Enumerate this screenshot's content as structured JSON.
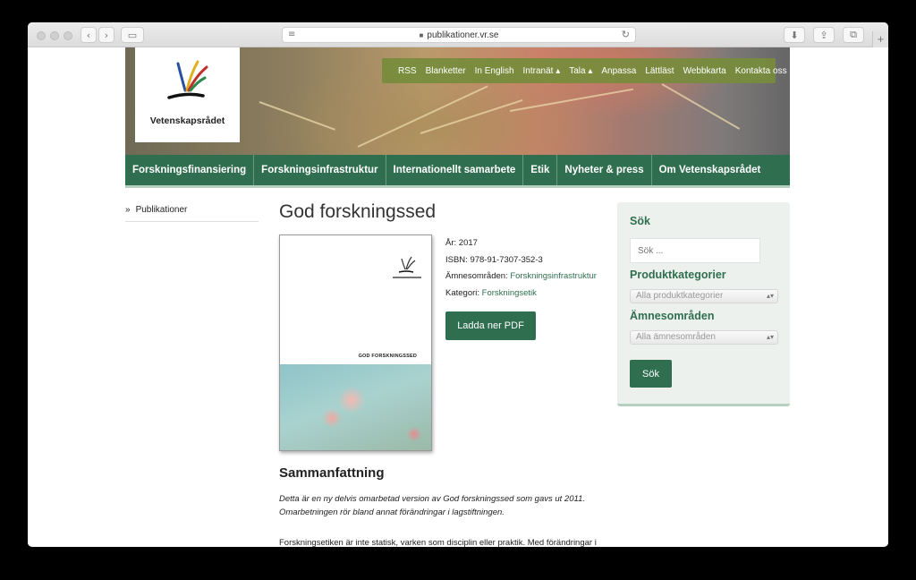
{
  "browser": {
    "url": "publikationer.vr.se",
    "icons": {
      "back": "‹",
      "forward": "›",
      "sidebar": "▭",
      "reader": "≡",
      "reload": "↻",
      "download": "⬇",
      "share": "⇪",
      "tabs": "⧉",
      "new_tab": "+"
    }
  },
  "site": {
    "logo_text": "Vetenskapsrådet",
    "top_links": [
      "RSS",
      "Blanketter",
      "In English",
      "Intranät ▴",
      "Tala ▴",
      "Anpassa",
      "Lättläst",
      "Webbkarta",
      "Kontakta oss"
    ],
    "main_nav": [
      "Forskningsfinansiering",
      "Forskningsinfrastruktur",
      "Internationellt samarbete",
      "Etik",
      "Nyheter & press",
      "Om Vetenskapsrådet"
    ]
  },
  "sidebar": {
    "chevron": "»",
    "item": "Publikationer"
  },
  "publication": {
    "title": "God forskningssed",
    "cover_title": "GOD FORSKNINGSSED",
    "year_label": "År:",
    "year": "2017",
    "isbn_label": "ISBN:",
    "isbn": "978-91-7307-352-3",
    "subject_label": "Ämnesområden:",
    "subject": "Forskningsinfrastruktur",
    "category_label": "Kategori:",
    "category": "Forskningsetik",
    "download_label": "Ladda ner PDF",
    "summary_heading": "Sammanfattning",
    "summary_text": "Detta är en ny delvis omarbetad version av God forskningssed som gavs ut 2011. Omarbetningen rör bland annat förändringar i lagstiftningen.",
    "body_text": "Forskningsetiken är inte statisk, varken som disciplin eller praktik. Med förändringar i"
  },
  "search_panel": {
    "heading": "Sök",
    "placeholder": "Sök ...",
    "category_heading": "Produktkategorier",
    "category_select": "Alla produktkategorier",
    "subject_heading": "Ämnesområden",
    "subject_select": "Alla ämnesområden",
    "select_arrow": "▴▾",
    "submit": "Sök"
  },
  "colors": {
    "brand_green": "#2f6f4f",
    "top_nav_green": "#768c3c"
  }
}
